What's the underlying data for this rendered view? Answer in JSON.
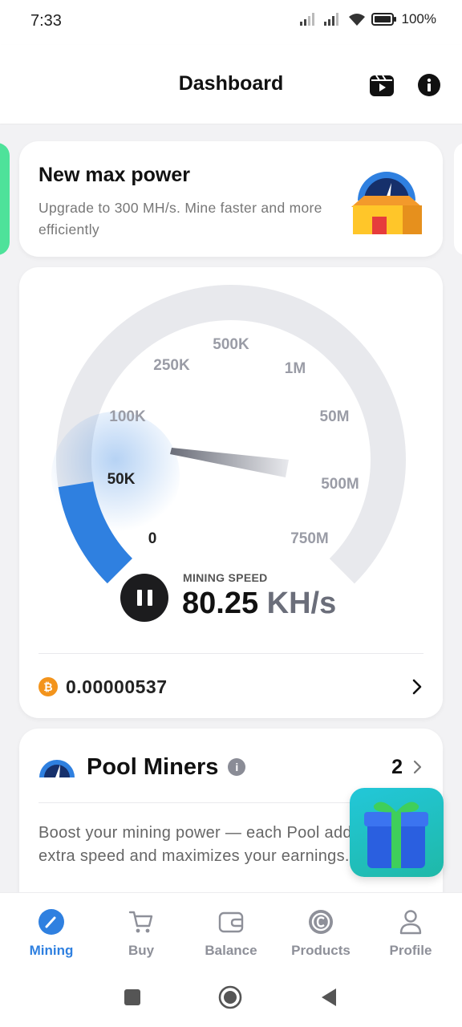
{
  "status_bar": {
    "time": "7:33",
    "battery": "100%"
  },
  "header": {
    "title": "Dashboard",
    "icons": [
      "video-icon",
      "info-icon"
    ]
  },
  "promo": {
    "title": "New max power",
    "text": "Upgrade to 300 MH/s. Mine faster and more efficiently"
  },
  "gauge": {
    "tick_labels": [
      "0",
      "50K",
      "100K",
      "250K",
      "500K",
      "1M",
      "50M",
      "500M",
      "750M"
    ],
    "label": "MINING SPEED",
    "value": "80.25",
    "unit": "KH/s",
    "colors": {
      "active": "#2f80e0",
      "track": "#e8e9ed"
    }
  },
  "balance": {
    "amount": "0.00000537",
    "coin_icon": "bitcoin-icon"
  },
  "pool": {
    "title": "Pool Miners",
    "count": "2",
    "description": "Boost your mining power — each Pool adds extra speed and maximizes your earnings."
  },
  "nav": {
    "items": [
      {
        "label": "Mining",
        "icon": "speedometer-icon",
        "active": true
      },
      {
        "label": "Buy",
        "icon": "cart-icon",
        "active": false
      },
      {
        "label": "Balance",
        "icon": "wallet-icon",
        "active": false
      },
      {
        "label": "Products",
        "icon": "coin-c-icon",
        "active": false
      },
      {
        "label": "Profile",
        "icon": "user-icon",
        "active": false
      }
    ]
  },
  "accent": "#2f80e0"
}
